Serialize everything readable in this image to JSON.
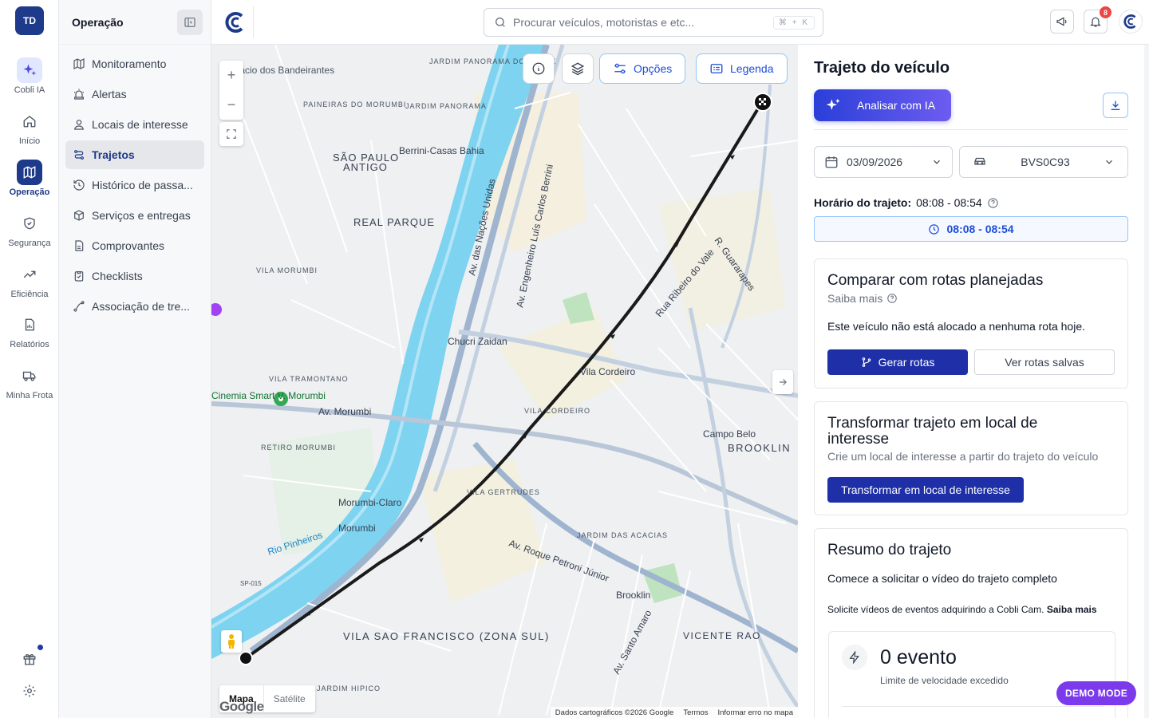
{
  "rail": {
    "avatar": "TD",
    "items": [
      {
        "label": "Cobli IA",
        "icon": "sparkles-icon"
      },
      {
        "label": "Início",
        "icon": "home-icon"
      },
      {
        "label": "Operação",
        "icon": "map-icon"
      },
      {
        "label": "Segurança",
        "icon": "shield-icon"
      },
      {
        "label": "Eficiência",
        "icon": "trending-up-icon"
      },
      {
        "label": "Relatórios",
        "icon": "report-icon"
      },
      {
        "label": "Minha Frota",
        "icon": "truck-icon"
      }
    ]
  },
  "nav": {
    "title": "Operação",
    "items": [
      {
        "label": "Monitoramento",
        "icon": "map-outline-icon"
      },
      {
        "label": "Alertas",
        "icon": "siren-icon"
      },
      {
        "label": "Locais de interesse",
        "icon": "location-user-icon"
      },
      {
        "label": "Trajetos",
        "icon": "route-icon",
        "active": true
      },
      {
        "label": "Histórico de passa...",
        "icon": "history-icon"
      },
      {
        "label": "Serviços e entregas",
        "icon": "package-icon"
      },
      {
        "label": "Comprovantes",
        "icon": "file-icon"
      },
      {
        "label": "Checklists",
        "icon": "clipboard-check-icon"
      },
      {
        "label": "Associação de tre...",
        "icon": "link-route-icon"
      }
    ]
  },
  "search": {
    "placeholder": "Procurar veículos, motoristas e etc...",
    "shortcut": "⌘ + K"
  },
  "notifications": {
    "count": "8"
  },
  "map": {
    "options_label": "Opções",
    "legend_label": "Legenda",
    "maptype_map": "Mapa",
    "maptype_satellite": "Satélite",
    "google": "Google",
    "attribution": [
      "Dados cartográficos ©2026 Google",
      "Termos",
      "Informar erro no mapa"
    ],
    "labels": [
      {
        "t": "Palácio dos Bandeirantes"
      },
      {
        "t": "JARDIM PANORAMA DO OESTE"
      },
      {
        "t": "JARDIM PANORAMA"
      },
      {
        "t": "PAINEIRAS DO MORUMBI"
      },
      {
        "t": "SÃO PAULO"
      },
      {
        "t": "ANTIGO"
      },
      {
        "t": "Berrini-Casas Bahia"
      },
      {
        "t": "REAL PARQUE"
      },
      {
        "t": "VILA MORUMBI"
      },
      {
        "t": "Chucri Zaidan"
      },
      {
        "t": "Vila Cordeiro"
      },
      {
        "t": "VILA CORDEIRO"
      },
      {
        "t": "VILA TRAMONTANO"
      },
      {
        "t": "Cinemia Smart V. Morumbi"
      },
      {
        "t": "Av. Morumbi"
      },
      {
        "t": "RETIRO MORUMBI"
      },
      {
        "t": "Campo Belo"
      },
      {
        "t": "BROOKLIN"
      },
      {
        "t": "VILA GERTRUDES"
      },
      {
        "t": "Morumbi-Claro"
      },
      {
        "t": "Morumbi"
      },
      {
        "t": "Rio Pinheiros"
      },
      {
        "t": "JARDIM DAS ACACIAS"
      },
      {
        "t": "Av. Roque Petroni Júnior"
      },
      {
        "t": "Brooklin"
      },
      {
        "t": "VILA SAO FRANCISCO (ZONA SUL)"
      },
      {
        "t": "VICENTE RAO"
      },
      {
        "t": "JARDIM HIPICO"
      },
      {
        "t": "SP-015"
      },
      {
        "t": "Av. das Nações Unidas"
      },
      {
        "t": "Av. Engenheiro Luís Carlos Berrini"
      },
      {
        "t": "Rua Ribeiro do Vale"
      },
      {
        "t": "R. Guararapes"
      },
      {
        "t": "Av. Santo Amaro"
      }
    ]
  },
  "panel": {
    "title": "Trajeto do veículo",
    "ai_button": "Analisar com IA",
    "date": "03/09/2026",
    "vehicle": "BVS0C93",
    "horario_label": "Horário do trajeto:",
    "horario_value": "08:08 - 08:54",
    "time_button": "08:08 - 08:54",
    "compare": {
      "title": "Comparar com rotas planejadas",
      "learn_more": "Saiba mais",
      "message": "Este veículo não está alocado a nenhuma rota hoje.",
      "generate": "Gerar rotas",
      "saved": "Ver rotas salvas"
    },
    "transform": {
      "title": "Transformar trajeto em local de interesse",
      "subtitle": "Crie um local de interesse a partir do trajeto do veículo",
      "button": "Transformar em local de interesse"
    },
    "summary": {
      "title": "Resumo do trajeto",
      "video": "Comece a solicitar o vídeo do trajeto completo",
      "cam_note": "Solicite vídeos de eventos adquirindo a Cobli Cam.",
      "cam_link": "Saiba mais",
      "events_count": "0 evento",
      "events_label": "Limite de velocidade excedido"
    }
  },
  "demo_mode": "DEMO MODE"
}
